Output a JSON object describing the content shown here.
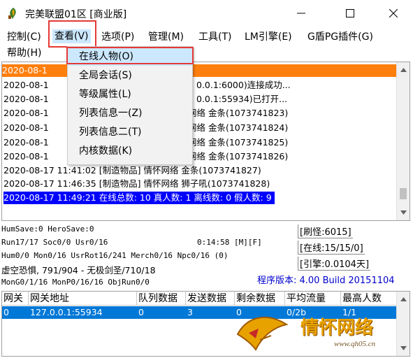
{
  "window": {
    "title": "完美联盟01区 [商业版]"
  },
  "menubar": {
    "items": [
      "控制(C)",
      "查看(V)",
      "选项(P)",
      "管理(M)",
      "工具(T)",
      "LM引擎(E)",
      "G盾PG插件(G)"
    ],
    "help": "帮助(H)"
  },
  "dropdown": {
    "items": [
      "在线人物(O)",
      "全局会话(S)",
      "等级属性(L)",
      "列表信息一(Z)",
      "列表信息二(T)",
      "内核数据(K)"
    ]
  },
  "log": {
    "lines": [
      "2020-08-1",
      "2020-08-1",
      "2020-08-1",
      "2020-08-1",
      "2020-08-1",
      "2020-08-1",
      "2020-08-1",
      "2020-08-17 11:41:02 [制造物品] 情怀网络 金条(1073741827)",
      "2020-08-17 11:46:35 [制造物品] 情怀网络 狮子吼(1073741828)",
      "2020-08-17 11:49:21 在线总数: 10 真人数: 1 离线数: 0 假人数: 9"
    ],
    "partial_right": [
      "0.0.1:6000)连接成功...",
      "0.0.1:55934)已打开...",
      "网络 金条(1073741823)",
      "网络 金条(1073741824)",
      "网络 金条(1073741825)",
      "网络 金条(1073741826)"
    ]
  },
  "status": {
    "line1": "HumSave:0 HeroSave:0",
    "line2": "Run17/17 Soc0/0 Usr0/16",
    "time": "0:14:58 [M][F]",
    "line3": "Hum0/0 Mon0/16 UsrRot16/241 Merch0/16 Npc0/16 (0)",
    "line4": "虚空恐惧, 791/904 - 无极剑圣/710/18",
    "line5": "MonG0/1/16 MonP0/16/16 ObjRun0/0",
    "refresh": "[刷怪:6015]",
    "online": "[在线:15/15/0]",
    "engine": "[引擎:0.0104天]",
    "version": "程序版本: 4.00 Build 20151104"
  },
  "table": {
    "headers": [
      "网关",
      "网关地址",
      "队列数据",
      "发送数据",
      "剩余数据",
      "平均流量",
      "最高人数"
    ],
    "rows": [
      [
        "0",
        "127.0.0.1:55934",
        "0",
        "3",
        "0",
        "0/2b",
        "1/1"
      ]
    ]
  },
  "watermark": {
    "title": "情怀网络",
    "url": "www.qh05.cn"
  },
  "colors": {
    "highlight_red": "#e53935",
    "orange_row": "#ff7f0e",
    "selected_blue": "#0000ff",
    "table_select": "#0078d7",
    "version_blue": "#0000cc"
  }
}
